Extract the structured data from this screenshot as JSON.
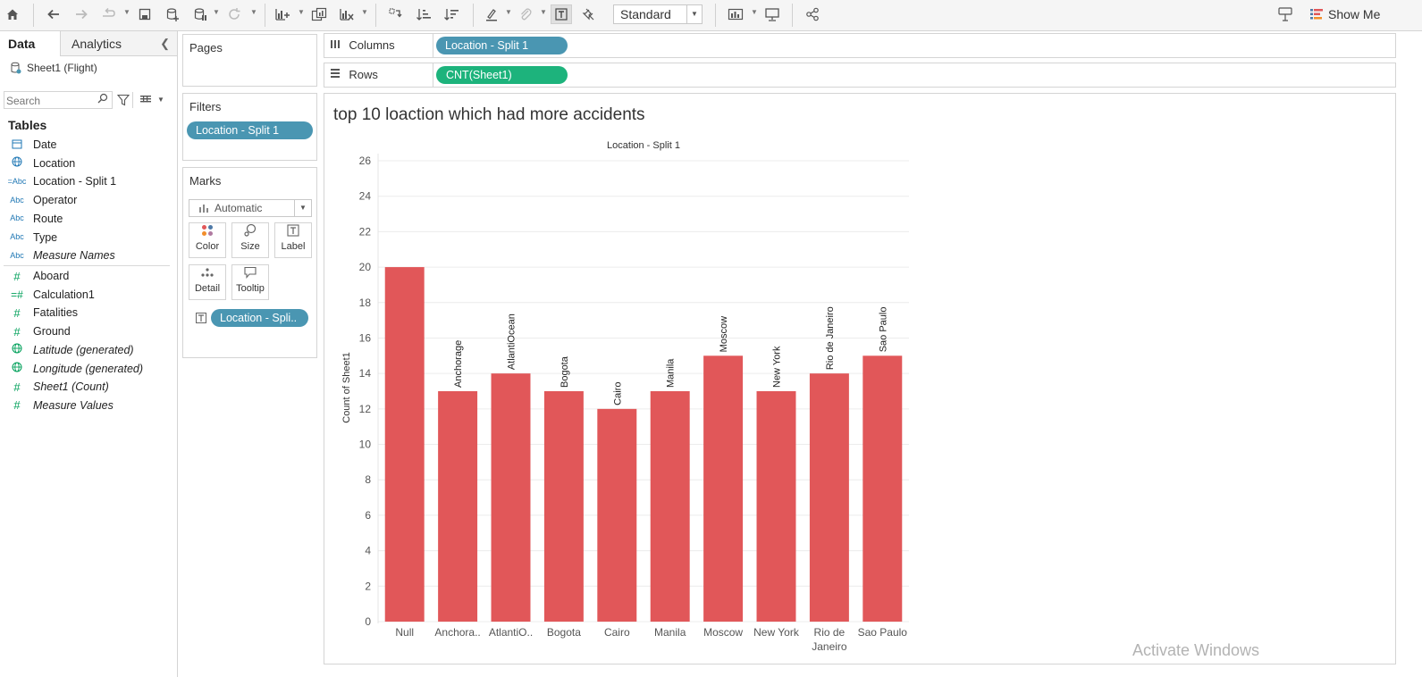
{
  "toolbar": {
    "view_mode": "Standard",
    "show_me_label": "Show Me",
    "icons": [
      "home-icon",
      "undo-icon",
      "redo-icon",
      "replay-icon",
      "save-icon",
      "new-datasource-icon",
      "pause-icon",
      "refresh-icon",
      "new-worksheet-icon",
      "duplicate-icon",
      "clear-sheet-icon",
      "swap-icon",
      "sort-ascending-icon",
      "sort-descending-icon",
      "highlight-icon",
      "group-icon",
      "show-labels-icon",
      "fix-axes-icon",
      "fit-icon",
      "presentation-icon",
      "share-icon",
      "tooltip-icon"
    ]
  },
  "data_pane": {
    "tabs": [
      "Data",
      "Analytics"
    ],
    "datasource": "Sheet1 (Flight)",
    "search_placeholder": "Search",
    "tables_title": "Tables",
    "dimensions": [
      {
        "label": "Date",
        "icon": "calendar-icon",
        "italic": false
      },
      {
        "label": "Location",
        "icon": "globe-icon",
        "italic": false
      },
      {
        "label": "Location - Split 1",
        "icon": "string-split-icon",
        "italic": false
      },
      {
        "label": "Operator",
        "icon": "abc-icon",
        "italic": false
      },
      {
        "label": "Route",
        "icon": "abc-icon",
        "italic": false
      },
      {
        "label": "Type",
        "icon": "abc-icon",
        "italic": false
      },
      {
        "label": "Measure Names",
        "icon": "abc-icon",
        "italic": true
      }
    ],
    "measures": [
      {
        "label": "Aboard",
        "icon": "number-icon",
        "italic": false
      },
      {
        "label": "Calculation1",
        "icon": "calc-number-icon",
        "italic": false
      },
      {
        "label": "Fatalities",
        "icon": "number-icon",
        "italic": false
      },
      {
        "label": "Ground",
        "icon": "number-icon",
        "italic": false
      },
      {
        "label": "Latitude (generated)",
        "icon": "globe-icon",
        "italic": true
      },
      {
        "label": "Longitude (generated)",
        "icon": "globe-icon",
        "italic": true
      },
      {
        "label": "Sheet1 (Count)",
        "icon": "number-icon",
        "italic": true
      },
      {
        "label": "Measure Values",
        "icon": "number-icon",
        "italic": true
      }
    ]
  },
  "pages_card": {
    "title": "Pages"
  },
  "filters_card": {
    "title": "Filters",
    "pill": "Location - Split 1"
  },
  "marks_card": {
    "title": "Marks",
    "mark_type": "Automatic",
    "buttons": [
      "Color",
      "Size",
      "Label",
      "Detail",
      "Tooltip"
    ],
    "label_pill": "Location - Spli.."
  },
  "shelves": {
    "columns_label": "Columns",
    "columns_pill": "Location - Split 1",
    "rows_label": "Rows",
    "rows_pill": "CNT(Sheet1)"
  },
  "view": {
    "title": "top 10 loaction which had more accidents",
    "watermark": "Activate Windows"
  },
  "colors": {
    "bar": "#e15759",
    "pill_dimension": "#4a96b2",
    "pill_measure": "#1db37c"
  },
  "chart_data": {
    "type": "bar",
    "header": "Location - Split 1",
    "ylabel": "Count of Sheet1",
    "ylim": [
      0,
      26
    ],
    "yticks": [
      0,
      2,
      4,
      6,
      8,
      10,
      12,
      14,
      16,
      18,
      20,
      22,
      24,
      26
    ],
    "categories": [
      "Null",
      "Anchorage",
      "AtlantiOcean",
      "Bogota",
      "Cairo",
      "Manila",
      "Moscow",
      "New York",
      "Rio de Janeiro",
      "Sao Paulo"
    ],
    "tick_labels": [
      [
        "Null"
      ],
      [
        "Anchora.."
      ],
      [
        "AtlantiO.."
      ],
      [
        "Bogota"
      ],
      [
        "Cairo"
      ],
      [
        "Manila"
      ],
      [
        "Moscow"
      ],
      [
        "New York"
      ],
      [
        "Rio de",
        "Janeiro"
      ],
      [
        "Sao Paulo"
      ]
    ],
    "values": [
      20,
      13,
      14,
      13,
      12,
      13,
      15,
      13,
      14,
      15
    ],
    "bar_labels": [
      "",
      "Anchorage",
      "AtlantiOcean",
      "Bogota",
      "Cairo",
      "Manila",
      "Moscow",
      "New York",
      "Rio de Janeiro",
      "Sao Paulo"
    ],
    "grid": true
  }
}
